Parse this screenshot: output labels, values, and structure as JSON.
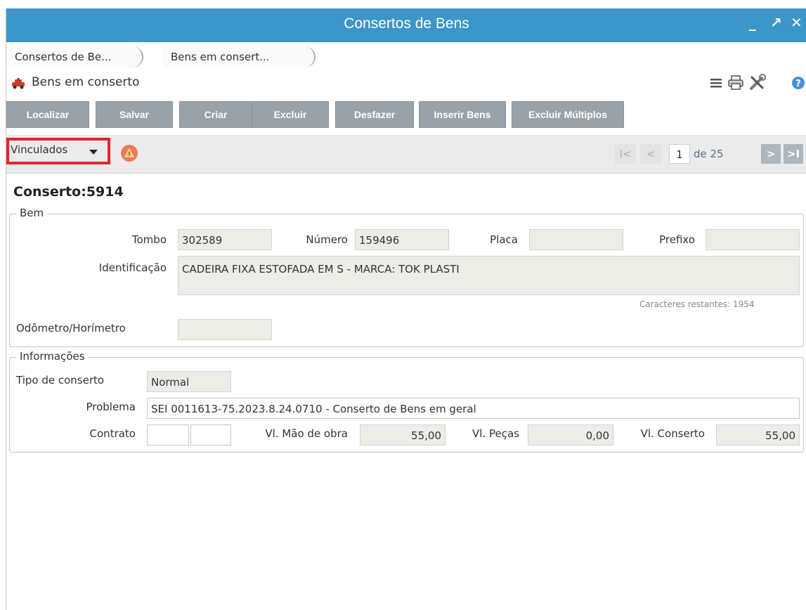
{
  "window": {
    "title": "Consertos de Bens",
    "controls": {
      "minimize": "_",
      "maximize": "↗",
      "close": "✕"
    }
  },
  "breadcrumbs": [
    "Consertos de Be...",
    "Bens em consert..."
  ],
  "header": {
    "caption": "Bens em conserto",
    "icons": [
      "menu-icon",
      "print-icon",
      "tools-icon",
      "help-icon"
    ]
  },
  "toolbar": {
    "localizar": "Localizar",
    "salvar": "Salvar",
    "criar": "Criar",
    "excluir": "Excluir",
    "desfazer": "Desfazer",
    "inserir_bens": "Inserir Bens",
    "excluir_multiplos": "Excluir Múltiplos"
  },
  "nav": {
    "vinculados": "Vinculados",
    "first": "I<",
    "prev": "<",
    "page": "1",
    "of_text": "de 25",
    "next": ">",
    "last": ">I"
  },
  "record": {
    "title": "Conserto:5914"
  },
  "bem": {
    "legend": "Bem",
    "tombo_label": "Tombo",
    "tombo_value": "302589",
    "numero_label": "Número",
    "numero_value": "159496",
    "placa_label": "Placa",
    "placa_value": "",
    "prefixo_label": "Prefixo",
    "prefixo_value": "",
    "identificacao_label": "Identificação",
    "identificacao_value": "CADEIRA FIXA ESTOFADA EM S - MARCA: TOK PLASTI",
    "caracteres_hint": "Caracteres restantes: 1954",
    "odometro_label": "Odômetro/Horímetro",
    "odometro_value": ""
  },
  "info": {
    "legend": "Informações",
    "tipo_label": "Tipo de conserto",
    "tipo_value": "Normal",
    "problema_label": "Problema",
    "problema_value": "SEI 0011613-75.2023.8.24.0710 - Conserto de Bens em geral",
    "contrato_label": "Contrato",
    "contrato_value_1": "",
    "contrato_value_2": "",
    "mao_obra_label": "Vl. Mão de obra",
    "mao_obra_value": "55,00",
    "pecas_label": "Vl. Peças",
    "pecas_value": "0,00",
    "conserto_label": "Vl. Conserto",
    "conserto_value": "55,00"
  },
  "colors": {
    "titlebar": "#3d96c9",
    "button": "#9aa2a9",
    "highlight": "#e4252f",
    "warning": "#f07a54"
  }
}
